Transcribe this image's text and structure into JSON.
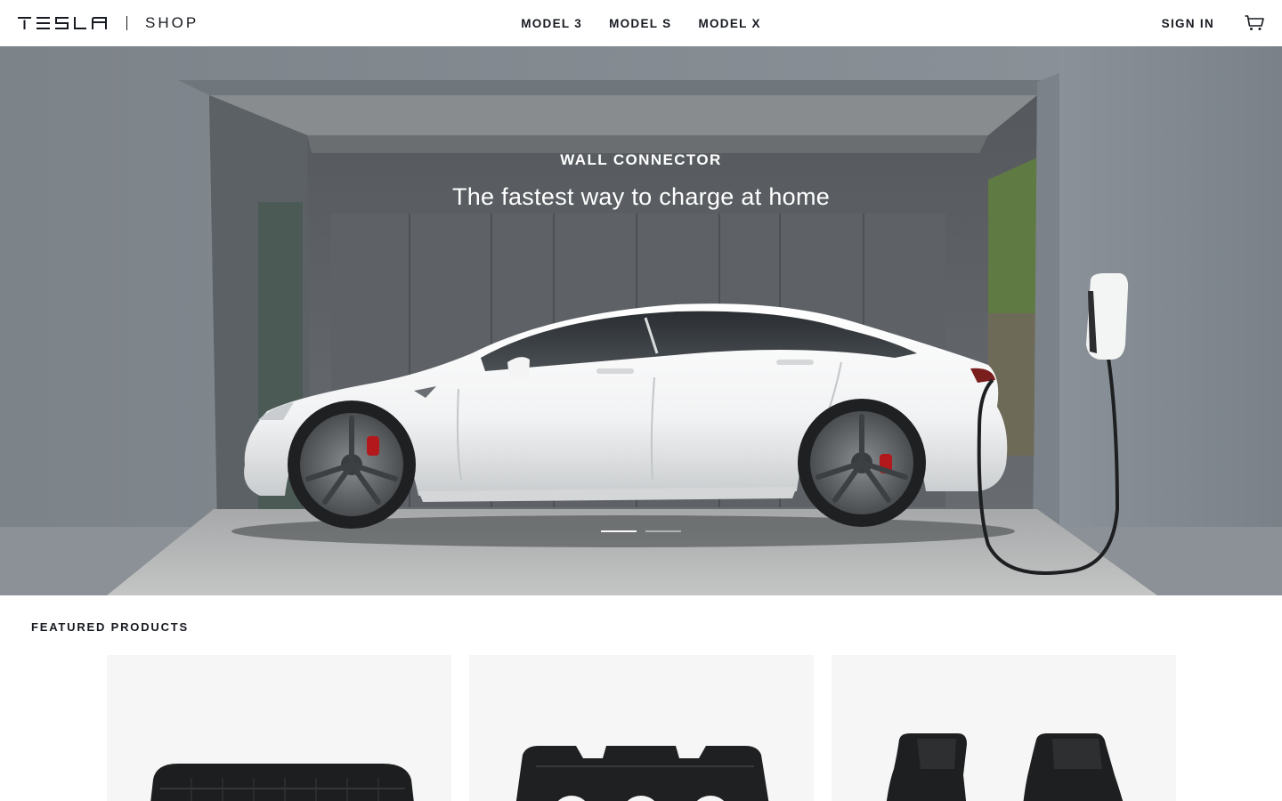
{
  "header": {
    "logo_icon": "tesla-wordmark",
    "shop_label": "SHOP",
    "nav": [
      {
        "label": "MODEL 3"
      },
      {
        "label": "MODEL S"
      },
      {
        "label": "MODEL X"
      }
    ],
    "sign_in_label": "SIGN IN",
    "cart_icon": "cart-icon"
  },
  "hero": {
    "eyebrow": "WALL CONNECTOR",
    "title": "The fastest way to charge at home",
    "slides": 2,
    "active_slide": 1
  },
  "featured": {
    "title": "FEATURED PRODUCTS",
    "products": [
      {
        "image": "front-trunk-liner"
      },
      {
        "image": "rear-floor-mats"
      },
      {
        "image": "front-floor-mats"
      }
    ]
  },
  "colors": {
    "text": "#171a20",
    "card_bg": "#f6f6f6"
  }
}
